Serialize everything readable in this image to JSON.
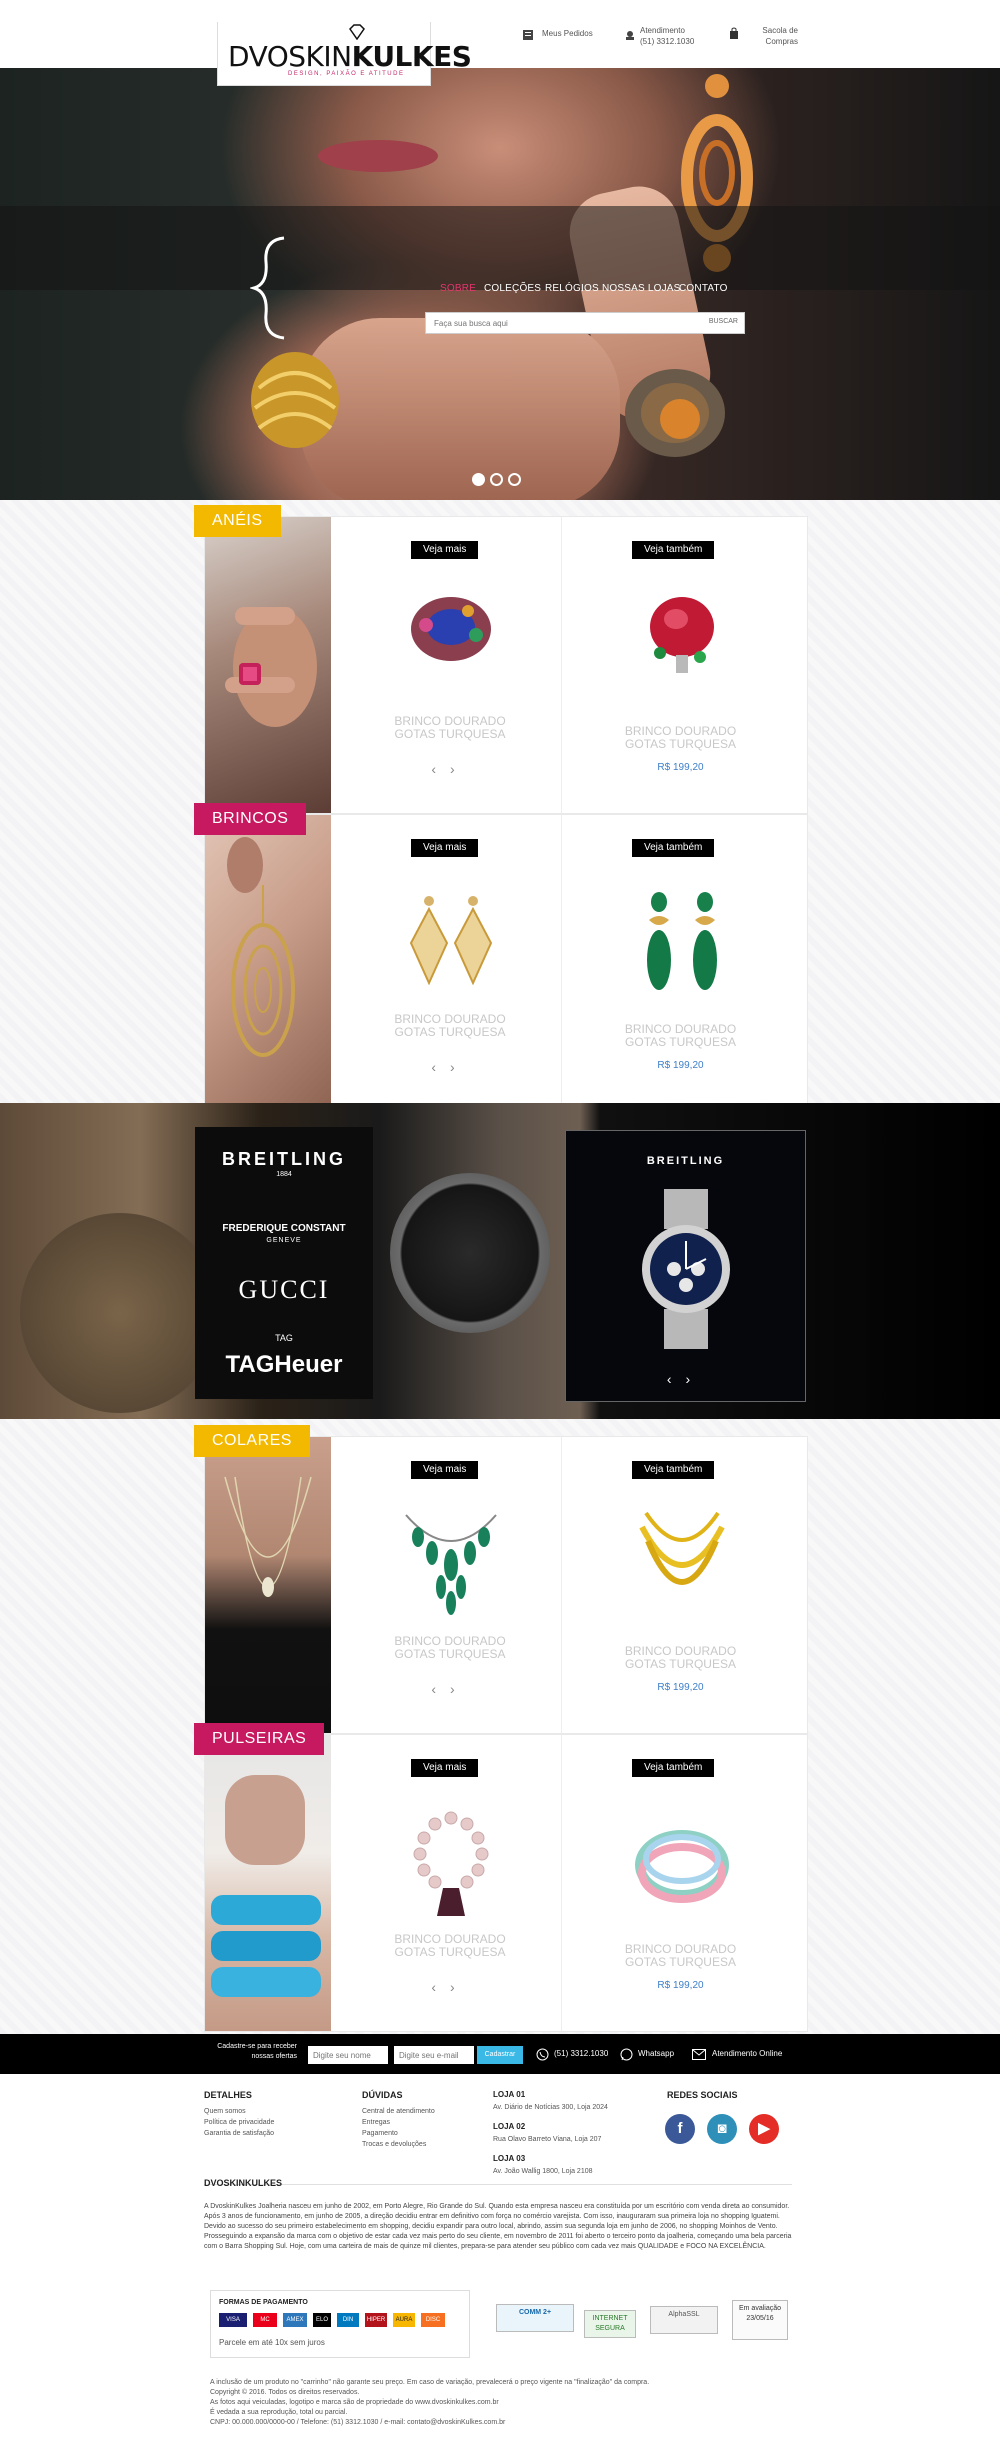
{
  "header": {
    "logo_light": "DVOSKIN",
    "logo_bold": "KULKES",
    "logo_tagline": "DESIGN, PAIXÃO E ATITUDE",
    "orders_label": "Meus Pedidos",
    "support_label_1": "Atendimento",
    "support_phone": "(51) 3312.1030",
    "cart_label_1": "Sacola de",
    "cart_label_2": "Compras"
  },
  "nav": {
    "items": [
      "SOBRE",
      "COLEÇÕES",
      "RELÓGIOS",
      "NOSSAS LOJAS",
      "CONTATO"
    ],
    "active": "SOBRE"
  },
  "search": {
    "placeholder": "Faça sua busca aqui",
    "button": "BUSCAR"
  },
  "sections": [
    {
      "title": "ANÉIS",
      "tag_color": "#f3b800",
      "left": {
        "tag": "Veja mais",
        "name_1": "BRINCO DOURADO",
        "name_2": "GOTAS TURQUESA",
        "prev": "‹",
        "next": "›"
      },
      "right": {
        "tag": "Veja também",
        "name_1": "BRINCO DOURADO",
        "name_2": "GOTAS TURQUESA",
        "price": "R$ 199,20"
      }
    },
    {
      "title": "BRINCOS",
      "tag_color": "#c6195f",
      "left": {
        "tag": "Veja mais",
        "name_1": "BRINCO DOURADO",
        "name_2": "GOTAS TURQUESA",
        "prev": "‹",
        "next": "›"
      },
      "right": {
        "tag": "Veja também",
        "name_1": "BRINCO DOURADO",
        "name_2": "GOTAS TURQUESA",
        "price": "R$ 199,20"
      }
    },
    {
      "title": "COLARES",
      "tag_color": "#f3b800",
      "left": {
        "tag": "Veja mais",
        "name_1": "BRINCO DOURADO",
        "name_2": "GOTAS TURQUESA",
        "prev": "‹",
        "next": "›"
      },
      "right": {
        "tag": "Veja também",
        "name_1": "BRINCO DOURADO",
        "name_2": "GOTAS TURQUESA",
        "price": "R$ 199,20"
      }
    },
    {
      "title": "PULSEIRAS",
      "tag_color": "#c6195f",
      "left": {
        "tag": "Veja mais",
        "name_1": "BRINCO DOURADO",
        "name_2": "GOTAS TURQUESA",
        "prev": "‹",
        "next": "›"
      },
      "right": {
        "tag": "Veja também",
        "name_1": "BRINCO DOURADO",
        "name_2": "GOTAS TURQUESA",
        "price": "R$ 199,20"
      }
    }
  ],
  "watches": {
    "brands": [
      {
        "name": "BREITLING",
        "sub": "1884"
      },
      {
        "name": "FREDERIQUE CONSTANT",
        "sub": "GENEVE"
      },
      {
        "name": "GUCCI",
        "sub": ""
      },
      {
        "name": "TAGHeuer",
        "sub": "TAG"
      }
    ],
    "card_brand": "BREITLING",
    "prev": "‹",
    "next": "›"
  },
  "newsletter": {
    "prompt_1": "Cadastre-se para receber",
    "prompt_2": "nossas ofertas",
    "name_placeholder": "Digite seu nome",
    "email_placeholder": "Digite seu e-mail",
    "submit": "Cadastrar",
    "phone": "(51) 3312.1030",
    "whatsapp": "Whatsapp",
    "online": "Atendimento Online"
  },
  "footer": {
    "details_title": "DETALHES",
    "details_links": [
      "Quem somos",
      "Política de privacidade",
      "Garantia de satisfação"
    ],
    "doubts_title": "DÚVIDAS",
    "doubts_links": [
      "Central de atendimento",
      "Entregas",
      "Pagamento",
      "Trocas e devoluções"
    ],
    "stores": [
      {
        "title": "LOJA 01",
        "address": "Av. Diário de Notícias 300, Loja 2024"
      },
      {
        "title": "LOJA 02",
        "address": "Rua Olavo Barreto Viana, Loja 207"
      },
      {
        "title": "LOJA 03",
        "address": "Av. João Wallig 1800, Loja 2108"
      }
    ],
    "social_title": "REDES SOCIAIS",
    "social": [
      {
        "name": "f",
        "color": "#3b5998"
      },
      {
        "name": "◙",
        "color": "#2e8fb8"
      },
      {
        "name": "▶",
        "color": "#e52d27"
      }
    ],
    "about_title": "DVOSKINKULKES",
    "about_text": "A DvoskinKulkes Joalheria nasceu em junho de 2002, em Porto Alegre, Rio Grande do Sul. Quando esta empresa nasceu era constituída por um escritório com venda direta ao consumidor. Após 3 anos de funcionamento, em junho de 2005, a direção decidiu entrar em definitivo com força no comércio varejista. Com isso, inauguraram sua primeira loja no shopping Iguatemi. Devido ao sucesso do seu primeiro estabelecimento em shopping, decidiu expandir para outro local, abrindo, assim sua segunda loja em junho de 2006, no shopping Moinhos de Vento. Prosseguindo a expansão da marca com o objetivo de estar cada vez mais perto do seu cliente, em novembro de 2011 foi aberto o terceiro ponto da joalheria, começando uma bela parceria com o Barra Shopping Sul. Hoje, com uma carteira de mais de quinze mil clientes, prepara-se para atender seu público com cada vez mais QUALIDADE e FOCO NA EXCELÊNCIA.",
    "payment_title": "FORMAS DE PAGAMENTO",
    "payment_cards": [
      "VISA",
      "MC",
      "AMEX",
      "ELO",
      "DIN",
      "HIPER",
      "AURA",
      "DISC"
    ],
    "installments": "Parcele em até 10x sem juros",
    "badges": [
      "COMM 2+",
      "INTERNET SEGURA",
      "AlphaSSL",
      "Em avaliação 23/05/16"
    ],
    "legal_lines": [
      "A inclusão de um produto no \"carrinho\" não garante seu preço. Em caso de variação, prevalecerá o preço vigente na \"finalização\" da compra.",
      "Copyright © 2016. Todos os direitos reservados.",
      "As fotos aqui veiculadas, logotipo e marca são de propriedade do www.dvoskinkulkes.com.br",
      "É vedada a sua reprodução, total ou parcial.",
      "CNPJ: 00.000.000/0000-00 / Telefone: (51) 3312.1030 / e-mail: contato@dvoskinKulkes.com.br"
    ]
  }
}
